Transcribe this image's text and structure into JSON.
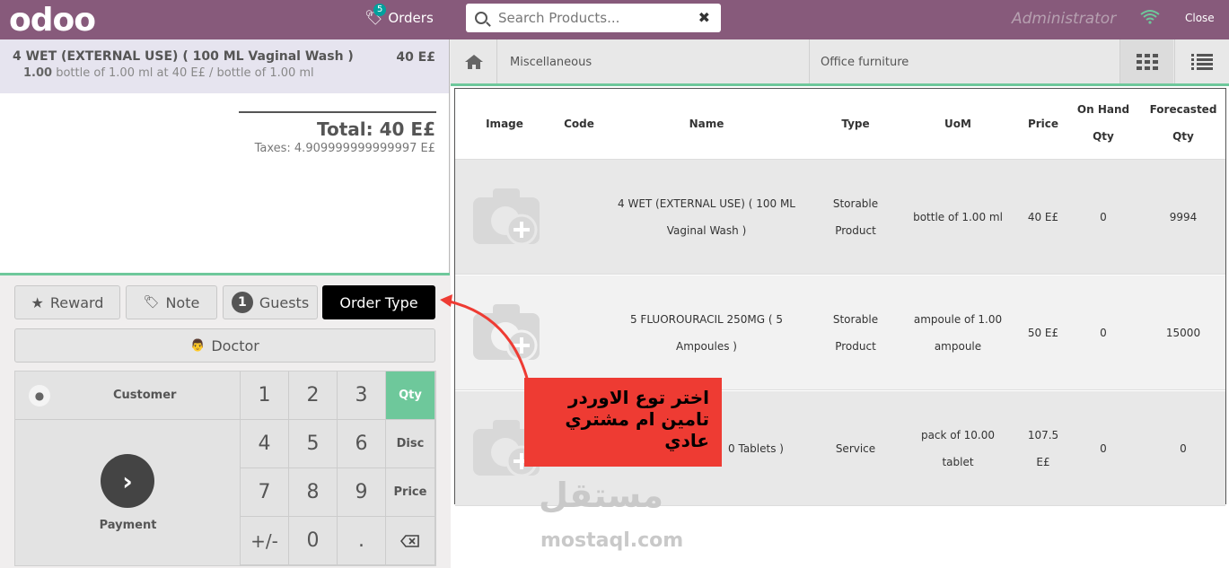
{
  "topbar": {
    "logo": "odoo",
    "orders_count": "5",
    "orders_label": "Orders",
    "search_placeholder": "Search Products...",
    "user": "Administrator",
    "close_label": "Close"
  },
  "order": {
    "line": {
      "name": "4 WET (EXTERNAL USE) ( 100 ML Vaginal Wash )",
      "price": "40 E£",
      "qty": "1.00",
      "detail": "bottle of 1.00 ml at 40 E£ / bottle of 1.00 ml"
    },
    "total": "Total: 40 E£",
    "taxes": "Taxes: 4.909999999999997 E£"
  },
  "controls": {
    "reward": "Reward",
    "note": "Note",
    "guests_count": "1",
    "guests": "Guests",
    "order_type": "Order Type",
    "doctor": "Doctor",
    "customer": "Customer",
    "payment": "Payment",
    "keys": [
      "1",
      "2",
      "3",
      "4",
      "5",
      "6",
      "7",
      "8",
      "9",
      "+/-",
      "0",
      "."
    ],
    "modes": [
      "Qty",
      "Disc",
      "Price"
    ]
  },
  "categories": {
    "left": "Miscellaneous",
    "right": "Office furniture"
  },
  "table": {
    "headers": {
      "image": "Image",
      "code": "Code",
      "name": "Name",
      "type": "Type",
      "uom": "UoM",
      "price": "Price",
      "onhand_1": "On Hand",
      "onhand_2": "Qty",
      "forecast_1": "Forecasted",
      "forecast_2": "Qty"
    },
    "rows": [
      {
        "name_1": "4 WET (EXTERNAL USE) ( 100 ML",
        "name_2": "Vaginal Wash )",
        "type_1": "Storable",
        "type_2": "Product",
        "uom_1": "bottle of 1.00 ml",
        "uom_2": "",
        "price_1": "40 E£",
        "price_2": "",
        "onhand": "0",
        "forecast": "9994"
      },
      {
        "name_1": "5 FLUOROURACIL 250MG ( 5",
        "name_2": "Ampoules )",
        "type_1": "Storable",
        "type_2": "Product",
        "uom_1": "ampoule of 1.00",
        "uom_2": "ampoule",
        "price_1": "50 E£",
        "price_2": "",
        "onhand": "0",
        "forecast": "15000"
      },
      {
        "name_1": "0 Tablets )",
        "name_2": "",
        "type_1": "Service",
        "type_2": "",
        "uom_1": "pack of 10.00",
        "uom_2": "tablet",
        "price_1": "107.5",
        "price_2": "E£",
        "onhand": "0",
        "forecast": "0"
      }
    ]
  },
  "annotation": {
    "line1": "اختر توع الاوردر",
    "line2": "تامين ام مشتري",
    "line3": "عادي",
    "color": "#ee3b33"
  },
  "watermark": {
    "arabic": "مستقل",
    "latin": "mostaql.com"
  },
  "colors": {
    "topbar": "#875a7b",
    "accent": "#6ec89b"
  }
}
